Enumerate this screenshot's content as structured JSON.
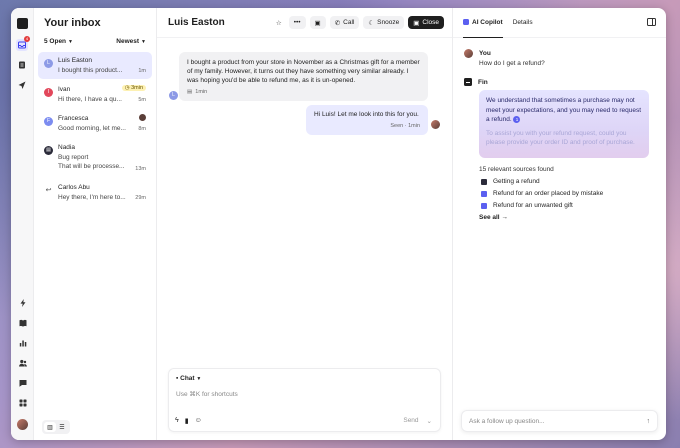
{
  "inbox": {
    "title": "Your inbox",
    "filter_label": "5 Open",
    "sort_label": "Newest",
    "conversations": [
      {
        "initial": "L",
        "name": "Luis Easton",
        "preview": "I bought this product...",
        "time": "1m",
        "color": "#8d9ae6"
      },
      {
        "initial": "I",
        "name": "Ivan",
        "preview": "Hi there, I have a qu...",
        "time": "5m",
        "tag": "3min",
        "color": "#e2475b"
      },
      {
        "initial": "F",
        "name": "Francesca",
        "preview": "Good morning, let me...",
        "time": "8m",
        "color": "#7c8cf0"
      },
      {
        "initial": "",
        "name": "Nadia",
        "preview": "Bug report",
        "preview2": "That will be processe...",
        "time": "13m",
        "color": "#2b2b3a"
      },
      {
        "initial": "",
        "name": "Carlos Abu",
        "preview": "Hey there, I'm here to...",
        "time": "29m",
        "color": "#ffffff"
      }
    ],
    "rail_badge": "4"
  },
  "conversation": {
    "title": "Luis Easton",
    "more_label": "•••",
    "call_label": "Call",
    "snooze_label": "Snooze",
    "close_label": "Close",
    "incoming": {
      "avatar": "L",
      "text": "I bought a product from your store in November as a Christmas gift for a member of my family. However, it turns out they have something very similar already. I was hoping you'd be able to refund me, as it is un-opened.",
      "time": "1min"
    },
    "outgoing": {
      "text": "Hi Luis! Let me look into this for you.",
      "meta": "Seen · 1min"
    },
    "composer": {
      "mode": "Chat",
      "placeholder": "Use ⌘K for shortcuts",
      "send_label": "Send"
    }
  },
  "copilot": {
    "tab_active": "AI Copilot",
    "tab_details": "Details",
    "you_label": "You",
    "question": "How do I get a refund?",
    "fin_label": "Fin",
    "answer_main": "We understand that sometimes a purchase may not meet your expectations, and you may need to request a refund.",
    "cite_number": "1",
    "answer_faded": "To assist you with your refund request, could you please provide your order ID and proof of purchase.",
    "sources_header": "15 relevant sources found",
    "sources": [
      {
        "label": "Getting a refund",
        "color": "#2b2b3a"
      },
      {
        "label": "Refund for an order placed by mistake",
        "color": "#5b5ff0"
      },
      {
        "label": "Refund for an unwanted gift",
        "color": "#5b5ff0"
      }
    ],
    "see_all": "See all →",
    "input_placeholder": "Ask a follow up question..."
  }
}
